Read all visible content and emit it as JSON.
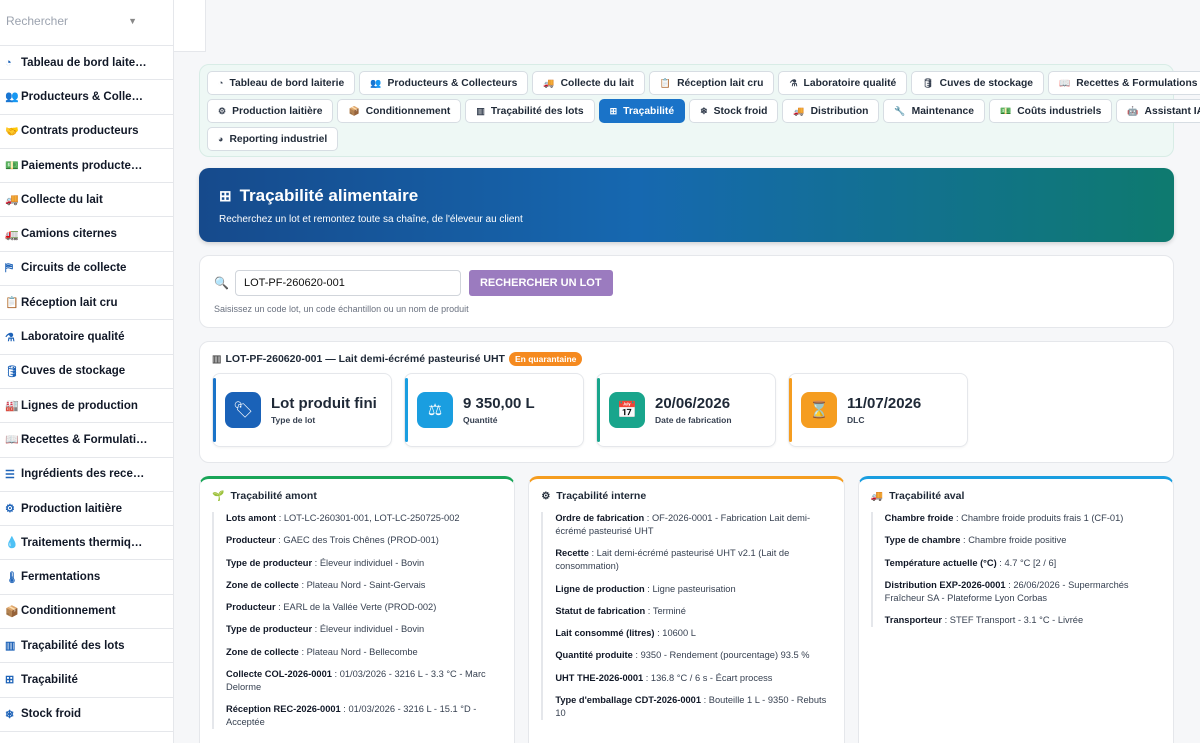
{
  "sidebar": {
    "search_placeholder": "Rechercher",
    "items": [
      {
        "icon": "gauge-icon",
        "glyph": "◔",
        "label": "Tableau de bord laite…"
      },
      {
        "icon": "users-icon",
        "glyph": "👥",
        "label": "Producteurs & Colle…"
      },
      {
        "icon": "handshake-icon",
        "glyph": "🤝",
        "label": "Contrats producteurs"
      },
      {
        "icon": "money-icon",
        "glyph": "💵",
        "label": "Paiements producte…"
      },
      {
        "icon": "truck-icon",
        "glyph": "🚚",
        "label": "Collecte du lait"
      },
      {
        "icon": "truck-tank-icon",
        "glyph": "🚛",
        "label": "Camions citernes"
      },
      {
        "icon": "signs-icon",
        "glyph": "⛿",
        "label": "Circuits de collecte"
      },
      {
        "icon": "clipboard-check-icon",
        "glyph": "📋",
        "label": "Réception lait cru"
      },
      {
        "icon": "flask-icon",
        "glyph": "⚗",
        "label": "Laboratoire qualité"
      },
      {
        "icon": "database-icon",
        "glyph": "🛢",
        "label": "Cuves de stockage"
      },
      {
        "icon": "industry-icon",
        "glyph": "🏭",
        "label": "Lignes de production"
      },
      {
        "icon": "book-icon",
        "glyph": "📖",
        "label": "Recettes & Formulati…"
      },
      {
        "icon": "list-icon",
        "glyph": "☰",
        "label": "Ingrédients des rece…"
      },
      {
        "icon": "cogs-icon",
        "glyph": "⚙",
        "label": "Production laitière"
      },
      {
        "icon": "fire-icon",
        "glyph": "💧",
        "label": "Traitements thermiq…"
      },
      {
        "icon": "thermometer-icon",
        "glyph": "🌡",
        "label": "Fermentations"
      },
      {
        "icon": "box-icon",
        "glyph": "📦",
        "label": "Conditionnement"
      },
      {
        "icon": "barcode-icon",
        "glyph": "▥",
        "label": "Traçabilité des lots"
      },
      {
        "icon": "sitemap-icon",
        "glyph": "⊞",
        "label": "Traçabilité"
      },
      {
        "icon": "snowflake-icon",
        "glyph": "❄",
        "label": "Stock froid"
      }
    ]
  },
  "tabs": {
    "row1": [
      {
        "icon": "gauge-icon",
        "glyph": "◔",
        "label": "Tableau de bord laiterie",
        "active": false
      },
      {
        "icon": "users-icon",
        "glyph": "👥",
        "label": "Producteurs & Collecteurs",
        "active": false
      },
      {
        "icon": "truck-icon",
        "glyph": "🚚",
        "label": "Collecte du lait",
        "active": false
      },
      {
        "icon": "clipboard-check-icon",
        "glyph": "📋",
        "label": "Réception lait cru",
        "active": false
      },
      {
        "icon": "flask-icon",
        "glyph": "⚗",
        "label": "Laboratoire qualité",
        "active": false
      },
      {
        "icon": "database-icon",
        "glyph": "🛢",
        "label": "Cuves de stockage",
        "active": false
      },
      {
        "icon": "book-icon",
        "glyph": "📖",
        "label": "Recettes & Formulations",
        "active": false
      }
    ],
    "row2": [
      {
        "icon": "cogs-icon",
        "glyph": "⚙",
        "label": "Production laitière",
        "active": false
      },
      {
        "icon": "box-icon",
        "glyph": "📦",
        "label": "Conditionnement",
        "active": false
      },
      {
        "icon": "barcode-icon",
        "glyph": "▥",
        "label": "Traçabilité des lots",
        "active": false
      },
      {
        "icon": "sitemap-icon",
        "glyph": "⊞",
        "label": "Traçabilité",
        "active": true
      },
      {
        "icon": "snowflake-icon",
        "glyph": "❄",
        "label": "Stock froid",
        "active": false
      },
      {
        "icon": "truck-loading-icon",
        "glyph": "🚚",
        "label": "Distribution",
        "active": false
      },
      {
        "icon": "wrench-icon",
        "glyph": "🔧",
        "label": "Maintenance",
        "active": false
      },
      {
        "icon": "money-icon",
        "glyph": "💵",
        "label": "Coûts industriels",
        "active": false
      },
      {
        "icon": "robot-icon",
        "glyph": "🤖",
        "label": "Assistant IA",
        "active": false
      }
    ],
    "row3": [
      {
        "icon": "chart-pie-icon",
        "glyph": "◕",
        "label": "Reporting industriel",
        "active": false
      }
    ]
  },
  "hero": {
    "title": "Traçabilité alimentaire",
    "subtitle": "Recherchez un lot et remontez toute sa chaîne, de l'éleveur au client"
  },
  "search": {
    "value": "LOT-PF-260620-001",
    "button": "RECHERCHER UN LOT",
    "hint": "Saisissez un code lot, un code échantillon ou un nom de produit"
  },
  "lot": {
    "title": "LOT-PF-260620-001 — Lait demi-écrémé pasteurisé UHT",
    "badge": "En quarantaine",
    "kpis": [
      {
        "icon": "tags-icon",
        "glyph": "🏷",
        "value": "Lot produit fini",
        "label": "Type de lot",
        "color": "blue"
      },
      {
        "icon": "balance-icon",
        "glyph": "⚖",
        "value": "9 350,00 L",
        "label": "Quantité",
        "color": "sky"
      },
      {
        "icon": "calendar-icon",
        "glyph": "📅",
        "value": "20/06/2026",
        "label": "Date de fabrication",
        "color": "teal"
      },
      {
        "icon": "hourglass-icon",
        "glyph": "⌛",
        "value": "11/07/2026",
        "label": "DLC",
        "color": "orange"
      }
    ]
  },
  "amont": {
    "title": "Traçabilité amont",
    "rows": [
      {
        "k": "Lots amont",
        "v": "LOT-LC-260301-001, LOT-LC-250725-002"
      },
      {
        "k": "Producteur",
        "v": "GAEC des Trois Chênes (PROD-001)"
      },
      {
        "k": "Type de producteur",
        "v": "Éleveur individuel - Bovin"
      },
      {
        "k": "Zone de collecte",
        "v": "Plateau Nord - Saint-Gervais"
      },
      {
        "k": "Producteur",
        "v": "EARL de la Vallée Verte (PROD-002)"
      },
      {
        "k": "Type de producteur",
        "v": "Éleveur individuel - Bovin"
      },
      {
        "k": "Zone de collecte",
        "v": "Plateau Nord - Bellecombe"
      },
      {
        "k": "Collecte COL-2026-0001",
        "v": "01/03/2026 - 3216 L - 3.3 °C - Marc Delorme"
      },
      {
        "k": "Réception REC-2026-0001",
        "v": "01/03/2026 - 3216 L - 15.1 °D - Acceptée"
      }
    ]
  },
  "interne": {
    "title": "Traçabilité interne",
    "rows": [
      {
        "k": "Ordre de fabrication",
        "v": "OF-2026-0001 - Fabrication Lait demi-écrémé pasteurisé UHT"
      },
      {
        "k": "Recette",
        "v": "Lait demi-écrémé pasteurisé UHT v2.1 (Lait de consommation)"
      },
      {
        "k": "Ligne de production",
        "v": "Ligne pasteurisation"
      },
      {
        "k": "Statut de fabrication",
        "v": "Terminé"
      },
      {
        "k": "Lait consommé (litres)",
        "v": "10600 L"
      },
      {
        "k": "Quantité produite",
        "v": "9350 - Rendement (pourcentage) 93.5 %"
      },
      {
        "k": "UHT THE-2026-0001",
        "v": "136.8 °C / 6 s - Écart process"
      },
      {
        "k": "Type d'emballage CDT-2026-0001",
        "v": "Bouteille 1 L - 9350 - Rebuts 10"
      }
    ]
  },
  "aval": {
    "title": "Traçabilité aval",
    "rows": [
      {
        "k": "Chambre froide",
        "v": "Chambre froide produits frais 1 (CF-01)"
      },
      {
        "k": "Type de chambre",
        "v": "Chambre froide positive"
      },
      {
        "k": "Température actuelle (°C)",
        "v": "4.7 °C [2 / 6]"
      },
      {
        "k": "Distribution EXP-2026-0001",
        "v": "26/06/2026 - Supermarchés Fraîcheur SA - Plateforme Lyon Corbas"
      },
      {
        "k": "Transporteur",
        "v": "STEF Transport - 3.1 °C - Livrée"
      }
    ]
  }
}
